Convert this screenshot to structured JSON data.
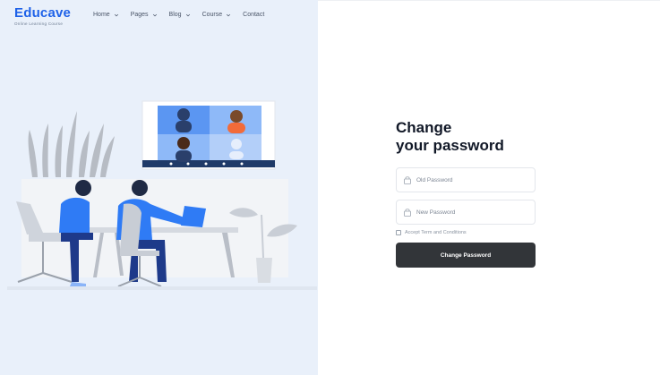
{
  "brand": {
    "name": "Educave",
    "tagline": "Online Learning Course"
  },
  "nav": {
    "items": [
      {
        "label": "Home",
        "has_dropdown": true
      },
      {
        "label": "Pages",
        "has_dropdown": true
      },
      {
        "label": "Blog",
        "has_dropdown": true
      },
      {
        "label": "Course",
        "has_dropdown": true
      },
      {
        "label": "Contact",
        "has_dropdown": false
      }
    ]
  },
  "form": {
    "title_line1": "Change",
    "title_line2": "your password",
    "old_password": {
      "placeholder": "Old Password",
      "value": ""
    },
    "new_password": {
      "placeholder": "New Password",
      "value": ""
    },
    "terms_label": "Accept Term and Conditions",
    "terms_checked": false,
    "submit_label": "Change Password"
  },
  "colors": {
    "brand": "#1f62e8",
    "left_background": "#e9f0fa",
    "button": "#323539",
    "illustration_accent": "#2f7bf5"
  },
  "icons": [
    "chevron-down-icon",
    "lock-icon",
    "checkbox-icon"
  ]
}
